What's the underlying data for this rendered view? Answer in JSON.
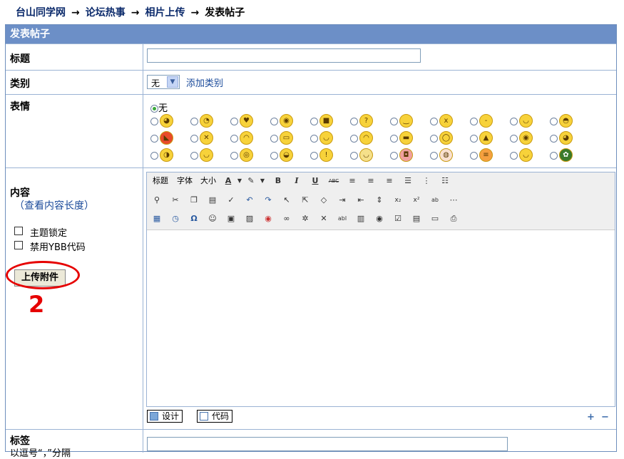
{
  "breadcrumb": {
    "items": [
      "台山同学网",
      "论坛热事",
      "相片上传",
      "发表帖子"
    ],
    "separator": "→"
  },
  "header": {
    "title": "发表帖子"
  },
  "fields": {
    "title_label": "标题",
    "title_value": "",
    "category_label": "类别",
    "category_selected": "无",
    "add_category": "添加类别",
    "emotion_label": "表情",
    "emotion_none": "无",
    "content_label": "内容",
    "content_length_link": "（查看内容长度）",
    "lock_topic": "主题锁定",
    "disable_ybb": "禁用YBB代码",
    "upload_button": "上传附件",
    "annotation_number": "2",
    "tag_label": "标签",
    "tag_hint": "以逗号“，”分隔"
  },
  "editor": {
    "toolbar_text": [
      "标题",
      "字体",
      "大小"
    ],
    "modes": [
      "设计",
      "代码"
    ],
    "plus": "+",
    "minus": "−"
  },
  "colors": {
    "header_bg": "#6c8fc7",
    "annotation_red": "#e60000",
    "link_blue": "#1a4a9a"
  }
}
